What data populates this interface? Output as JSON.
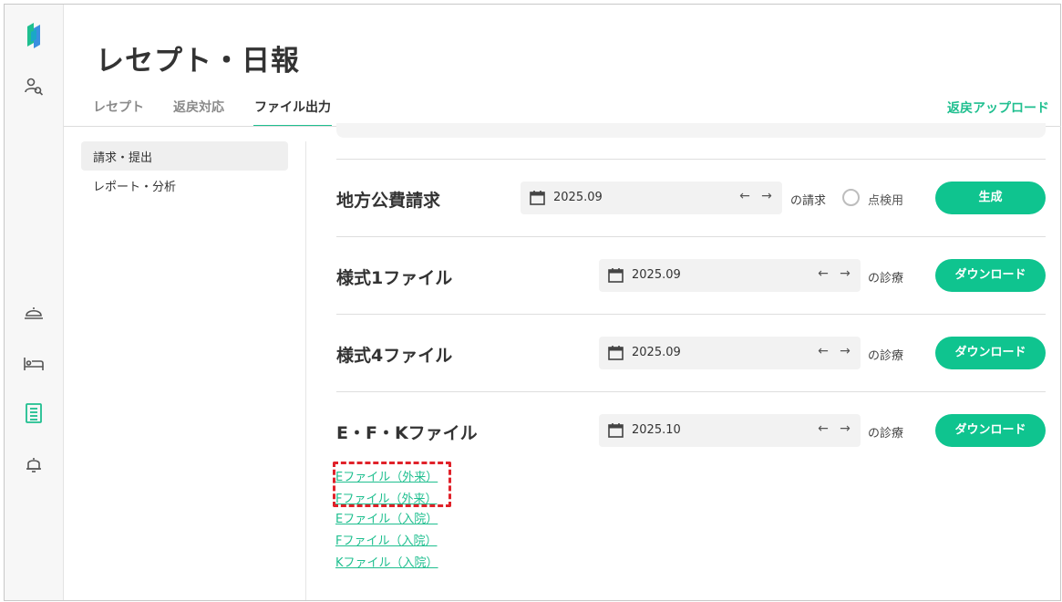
{
  "app": {
    "accent_color": "#1fbf8f",
    "button_color": "#0fc48f"
  },
  "rail": {
    "items": [
      {
        "icon": "logo-icon"
      },
      {
        "icon": "user-search-icon"
      },
      {
        "icon": "meal-cover-icon"
      },
      {
        "icon": "bed-icon"
      },
      {
        "icon": "receipt-icon",
        "active": true
      },
      {
        "icon": "bell-icon"
      }
    ]
  },
  "header": {
    "title": "レセプト・日報",
    "tabs": [
      {
        "label": "レセプト"
      },
      {
        "label": "返戻対応"
      },
      {
        "label": "ファイル出力",
        "active": true
      }
    ],
    "upload_label": "返戻アップロード"
  },
  "subnav": {
    "items": [
      {
        "label": "請求・提出",
        "active": true
      },
      {
        "label": "レポート・分析"
      }
    ]
  },
  "rows": [
    {
      "title": "地方公費請求",
      "date": "2025.09",
      "suffix": "の請求",
      "radio_label": "点検用",
      "button": "生成"
    },
    {
      "title": "様式1ファイル",
      "date": "2025.09",
      "suffix": "の診療",
      "button": "ダウンロード"
    },
    {
      "title": "様式4ファイル",
      "date": "2025.09",
      "suffix": "の診療",
      "button": "ダウンロード"
    },
    {
      "title": "E・F・Kファイル",
      "date": "2025.10",
      "suffix": "の診療",
      "button": "ダウンロード"
    }
  ],
  "arrows": {
    "prev": "←",
    "next": "→"
  },
  "file_links": [
    "Eファイル（外来）",
    "Fファイル（外来）",
    "Eファイル（入院）",
    "Fファイル（入院）",
    "Kファイル（入院）"
  ]
}
